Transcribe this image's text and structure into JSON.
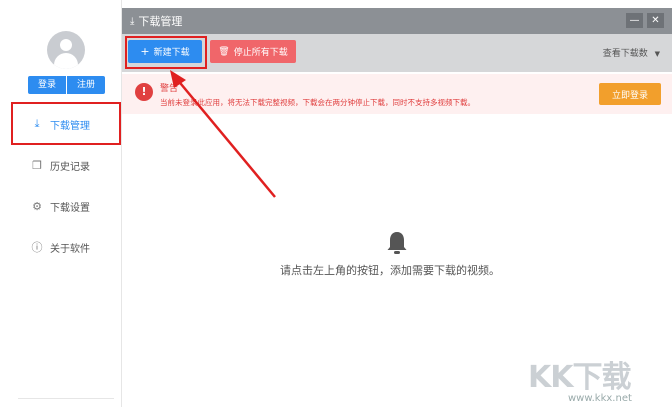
{
  "sidebar": {
    "login_label": "登录",
    "register_label": "注册",
    "items": [
      {
        "label": "下载管理",
        "icon": "download-icon"
      },
      {
        "label": "历史记录",
        "icon": "history-icon"
      },
      {
        "label": "下载设置",
        "icon": "settings-icon"
      },
      {
        "label": "关于软件",
        "icon": "info-icon"
      }
    ]
  },
  "window": {
    "title": "下载管理",
    "minimize": "—",
    "close": "✕"
  },
  "toolbar": {
    "new_download": "新建下载",
    "stop_all": "停止所有下载",
    "view_count": "查看下载数"
  },
  "alert": {
    "title": "警告",
    "message": "当前未登录此应用，将无法下载完整视频，下载会在两分钟停止下载，同时不支持多视频下载。",
    "login_now": "立即登录"
  },
  "main": {
    "empty_text": "请点击左上角的按钮，添加需要下载的视频。"
  },
  "watermark": {
    "logo": "KK下载",
    "url": "www.kkx.net"
  },
  "colors": {
    "primary": "#2d8cf0",
    "danger": "#f0666a",
    "warning": "#f29f2c",
    "titlebar": "#8c9095",
    "highlight": "#e02020"
  }
}
